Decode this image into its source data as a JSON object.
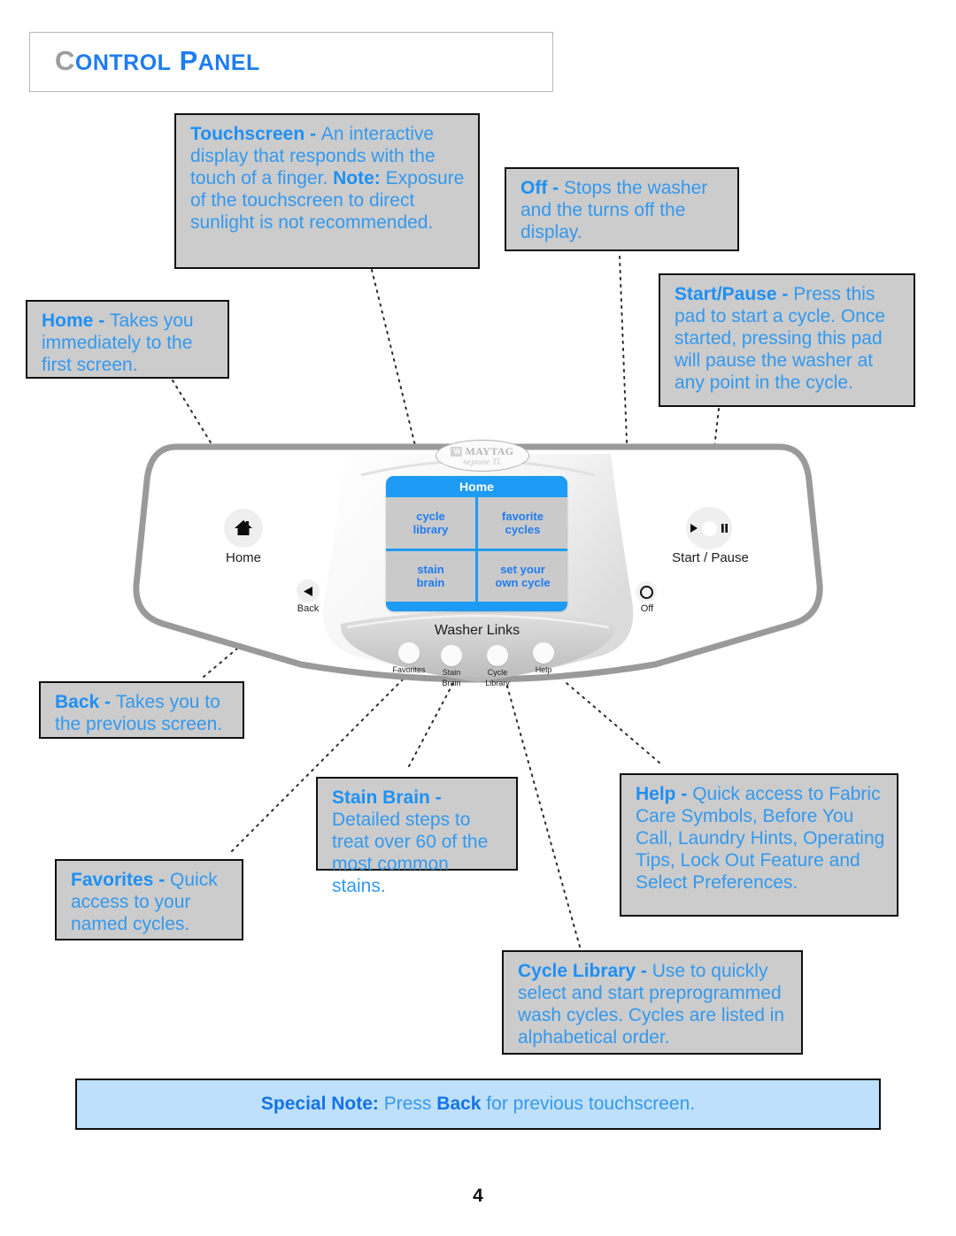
{
  "header": {
    "title_first_letter": "C",
    "title_part1": "ONTROL",
    "title_second_letter": "P",
    "title_part2": "ANEL",
    "title_full": "Control Panel"
  },
  "colors": {
    "accent_blue": "#3399ee",
    "bold_blue": "#1e90f5",
    "title_gray": "#9d9d9d",
    "callout_bg": "#cccccc",
    "note_bg": "#bfe0fb",
    "screen_blue": "#1e9bf5"
  },
  "callouts": [
    {
      "id": "touchscreen",
      "term": "Touchscreen",
      "dash": " - ",
      "body": "An interactive display that responds with the touch of a finger.",
      "term2": "Note:",
      "body2": " Exposure of the touchscreen to direct sunlight is not recommended."
    },
    {
      "id": "off",
      "term": "Off",
      "dash": " - ",
      "body": "Stops the washer and the turns off the display."
    },
    {
      "id": "start-pause",
      "term": "Start/Pause",
      "dash": " - ",
      "body": "Press this pad to start a cycle.  Once started, pressing this pad will pause the washer at any point in the cycle."
    },
    {
      "id": "home",
      "term": "Home",
      "dash": " - ",
      "body": "Takes you immediately to the first screen."
    },
    {
      "id": "back",
      "term": "Back",
      "dash": " - ",
      "body": "Takes you to the previous screen."
    },
    {
      "id": "stain-brain",
      "term": "Stain Brain",
      "dash": " - ",
      "body": "Detailed steps to treat over 60 of the most common stains."
    },
    {
      "id": "help",
      "term": "Help",
      "dash": " - ",
      "body": "Quick access to Fabric Care Symbols, Before You Call, Laundry Hints, Operating Tips, Lock Out Feature and Select Preferences."
    },
    {
      "id": "favorites",
      "term": "Favorites",
      "dash": " - ",
      "body": "Quick access to your named cycles."
    },
    {
      "id": "cycle-library",
      "term": "Cycle Library",
      "dash": " - ",
      "body": "Use to quickly select and start preprogrammed wash cycles.  Cycles are listed in alphabetical order."
    }
  ],
  "special_note": {
    "label": "Special Note:",
    "text_before": "  Press ",
    "emphasis": "Back",
    "text_after": " for previous touchscreen."
  },
  "washer": {
    "brand_mark": "W",
    "brand_name": "MAYTAG",
    "brand_model": "neptune TL",
    "touchscreen": {
      "title": "Home",
      "cells": [
        {
          "line1": "cycle",
          "line2": "library"
        },
        {
          "line1": "favorite",
          "line2": "cycles"
        },
        {
          "line1": "stain",
          "line2": "brain"
        },
        {
          "line1": "set your",
          "line2": "own cycle"
        }
      ]
    },
    "pads": {
      "home_label": "Home",
      "back_label": "Back",
      "start_pause_label": "Start / Pause",
      "off_label": "Off"
    },
    "washer_links": {
      "title": "Washer Links",
      "buttons": [
        {
          "line1": "Favorites",
          "line2": ""
        },
        {
          "line1": "Stain",
          "line2": "Brain"
        },
        {
          "line1": "Cycle",
          "line2": "Library"
        },
        {
          "line1": "Help",
          "line2": ""
        }
      ]
    }
  },
  "footer": {
    "page_number": "4"
  }
}
